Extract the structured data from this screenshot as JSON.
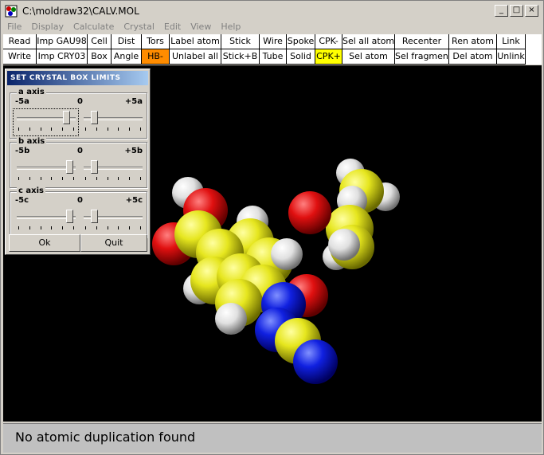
{
  "window": {
    "title": "C:\\moldraw32\\CALV.MOL",
    "min": "_",
    "max": "□",
    "close": "×"
  },
  "menu": [
    "File",
    "Display",
    "Calculate",
    "Crystal",
    "Edit",
    "View",
    "Help"
  ],
  "toolbar": {
    "row1": [
      "Read",
      "Imp GAU98",
      "Cell",
      "Dist",
      "Tors",
      "Label atom",
      "Stick",
      "Wire",
      "Spoke",
      "CPK-",
      "Sel all atom",
      "Recenter",
      "Ren atom",
      "Link"
    ],
    "row2": [
      "Write",
      "Imp CRY03",
      "Box",
      "Angle",
      "HB-",
      "Unlabel all",
      "Stick+B",
      "Tube",
      "Solid",
      "CPK+",
      "Sel atom",
      "Sel fragment",
      "Del atom",
      "Unlink"
    ],
    "highlight_orange": "#ff8c00",
    "highlight_yellow": "#ffff00"
  },
  "dialog": {
    "title": "SET CRYSTAL BOX LIMITS",
    "groups": [
      {
        "legend": "a  axis",
        "min": "-5a",
        "mid": "0",
        "max": "+5a"
      },
      {
        "legend": "b  axis",
        "min": "-5b",
        "mid": "0",
        "max": "+5b"
      },
      {
        "legend": "c  axis",
        "min": "-5c",
        "mid": "0",
        "max": "+5c"
      }
    ],
    "ok": "Ok",
    "quit": "Quit"
  },
  "molecule": {
    "colors": {
      "carbon": "#e6e61e",
      "oxygen": "#e01010",
      "nitrogen": "#1020e0",
      "hydrogen": "#f0f0f0"
    }
  },
  "status": "No atomic duplication found"
}
